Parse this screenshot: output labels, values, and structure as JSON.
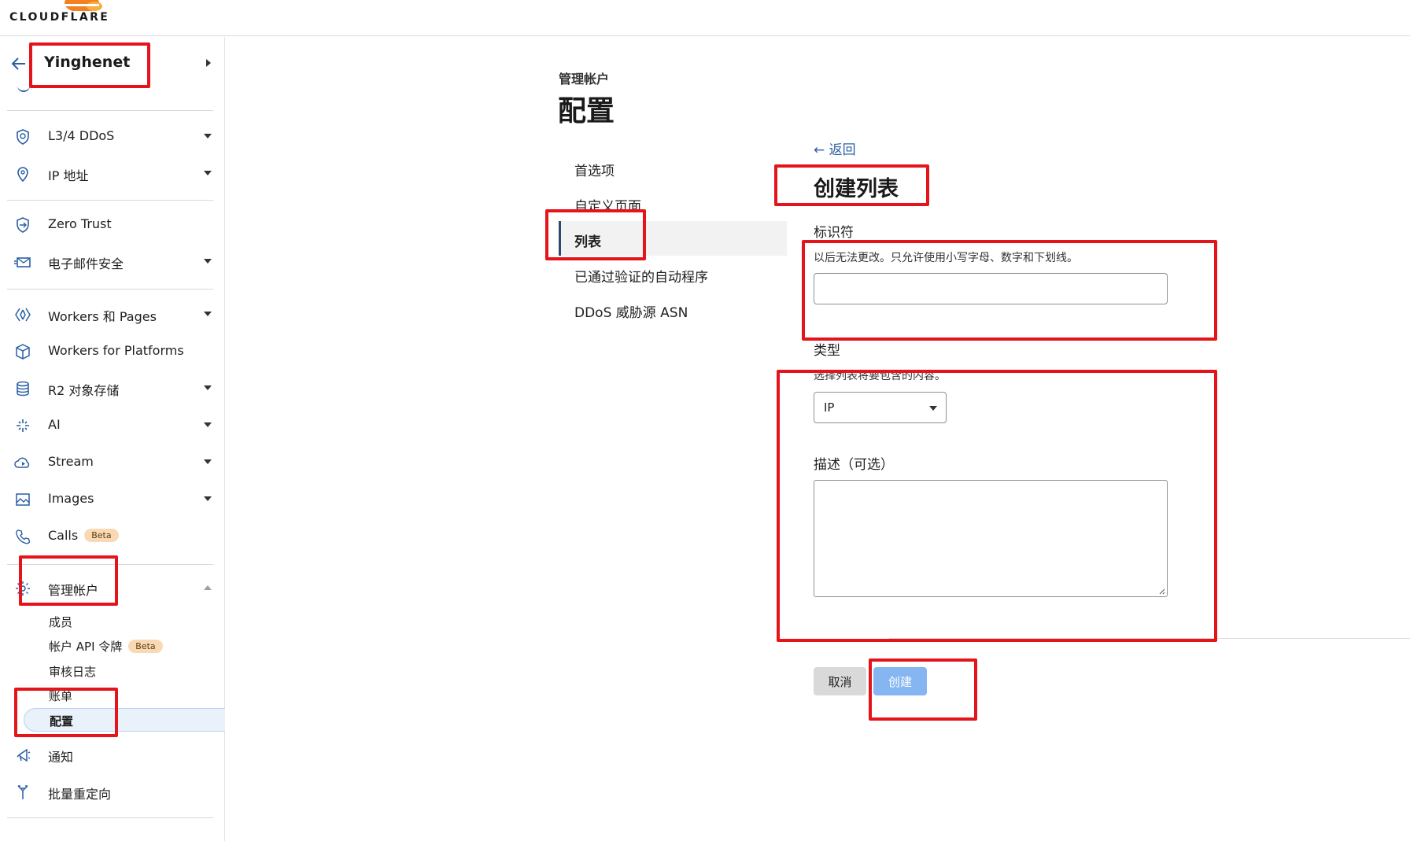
{
  "brand": {
    "logo_text": "CLOUDFLARE"
  },
  "account": {
    "name": "Yinghenet"
  },
  "sidebar": {
    "items": [
      {
        "label": "L3/4 DDoS",
        "icon": "shield-icon"
      },
      {
        "label": "IP 地址",
        "icon": "location-pin-icon"
      },
      {
        "label": "Zero Trust",
        "icon": "zero-trust-icon"
      },
      {
        "label": "电子邮件安全",
        "icon": "email-icon"
      },
      {
        "label": "Workers 和 Pages",
        "icon": "workers-icon"
      },
      {
        "label": "Workers for Platforms",
        "icon": "cube-icon"
      },
      {
        "label": "R2 对象存储",
        "icon": "database-icon"
      },
      {
        "label": "AI",
        "icon": "sparkle-icon"
      },
      {
        "label": "Stream",
        "icon": "stream-icon"
      },
      {
        "label": "Images",
        "icon": "image-icon"
      },
      {
        "label": "Calls",
        "icon": "phone-icon",
        "badge": "Beta"
      },
      {
        "label": "管理帐户",
        "icon": "gear-icon"
      },
      {
        "label": "通知",
        "icon": "megaphone-icon"
      },
      {
        "label": "批量重定向",
        "icon": "redirect-icon"
      }
    ],
    "manage_sub": [
      {
        "label": "成员"
      },
      {
        "label": "帐户 API 令牌",
        "badge": "Beta"
      },
      {
        "label": "审核日志"
      },
      {
        "label": "账单"
      },
      {
        "label": "配置"
      }
    ]
  },
  "page": {
    "breadcrumb": "管理帐户",
    "title": "配置",
    "subnav": [
      {
        "label": "首选项"
      },
      {
        "label": "自定义页面"
      },
      {
        "label": "列表"
      },
      {
        "label": "已通过验证的自动程序"
      },
      {
        "label": "DDoS 威胁源 ASN"
      }
    ]
  },
  "form": {
    "back_label": "返回",
    "title": "创建列表",
    "identifier_label": "标识符",
    "identifier_help": "以后无法更改。只允许使用小写字母、数字和下划线。",
    "identifier_value": "",
    "type_label": "类型",
    "type_help": "选择列表将要包含的内容。",
    "type_value": "IP",
    "description_label": "描述（可选）",
    "description_value": "",
    "cancel_label": "取消",
    "create_label": "创建"
  },
  "colors": {
    "accent_blue": "#2b5fa5",
    "create_button": "#86b6f2",
    "cloudflare_orange": "#f48120",
    "annotation_red": "#e5141b",
    "beta_badge": "#f9d9b3"
  }
}
